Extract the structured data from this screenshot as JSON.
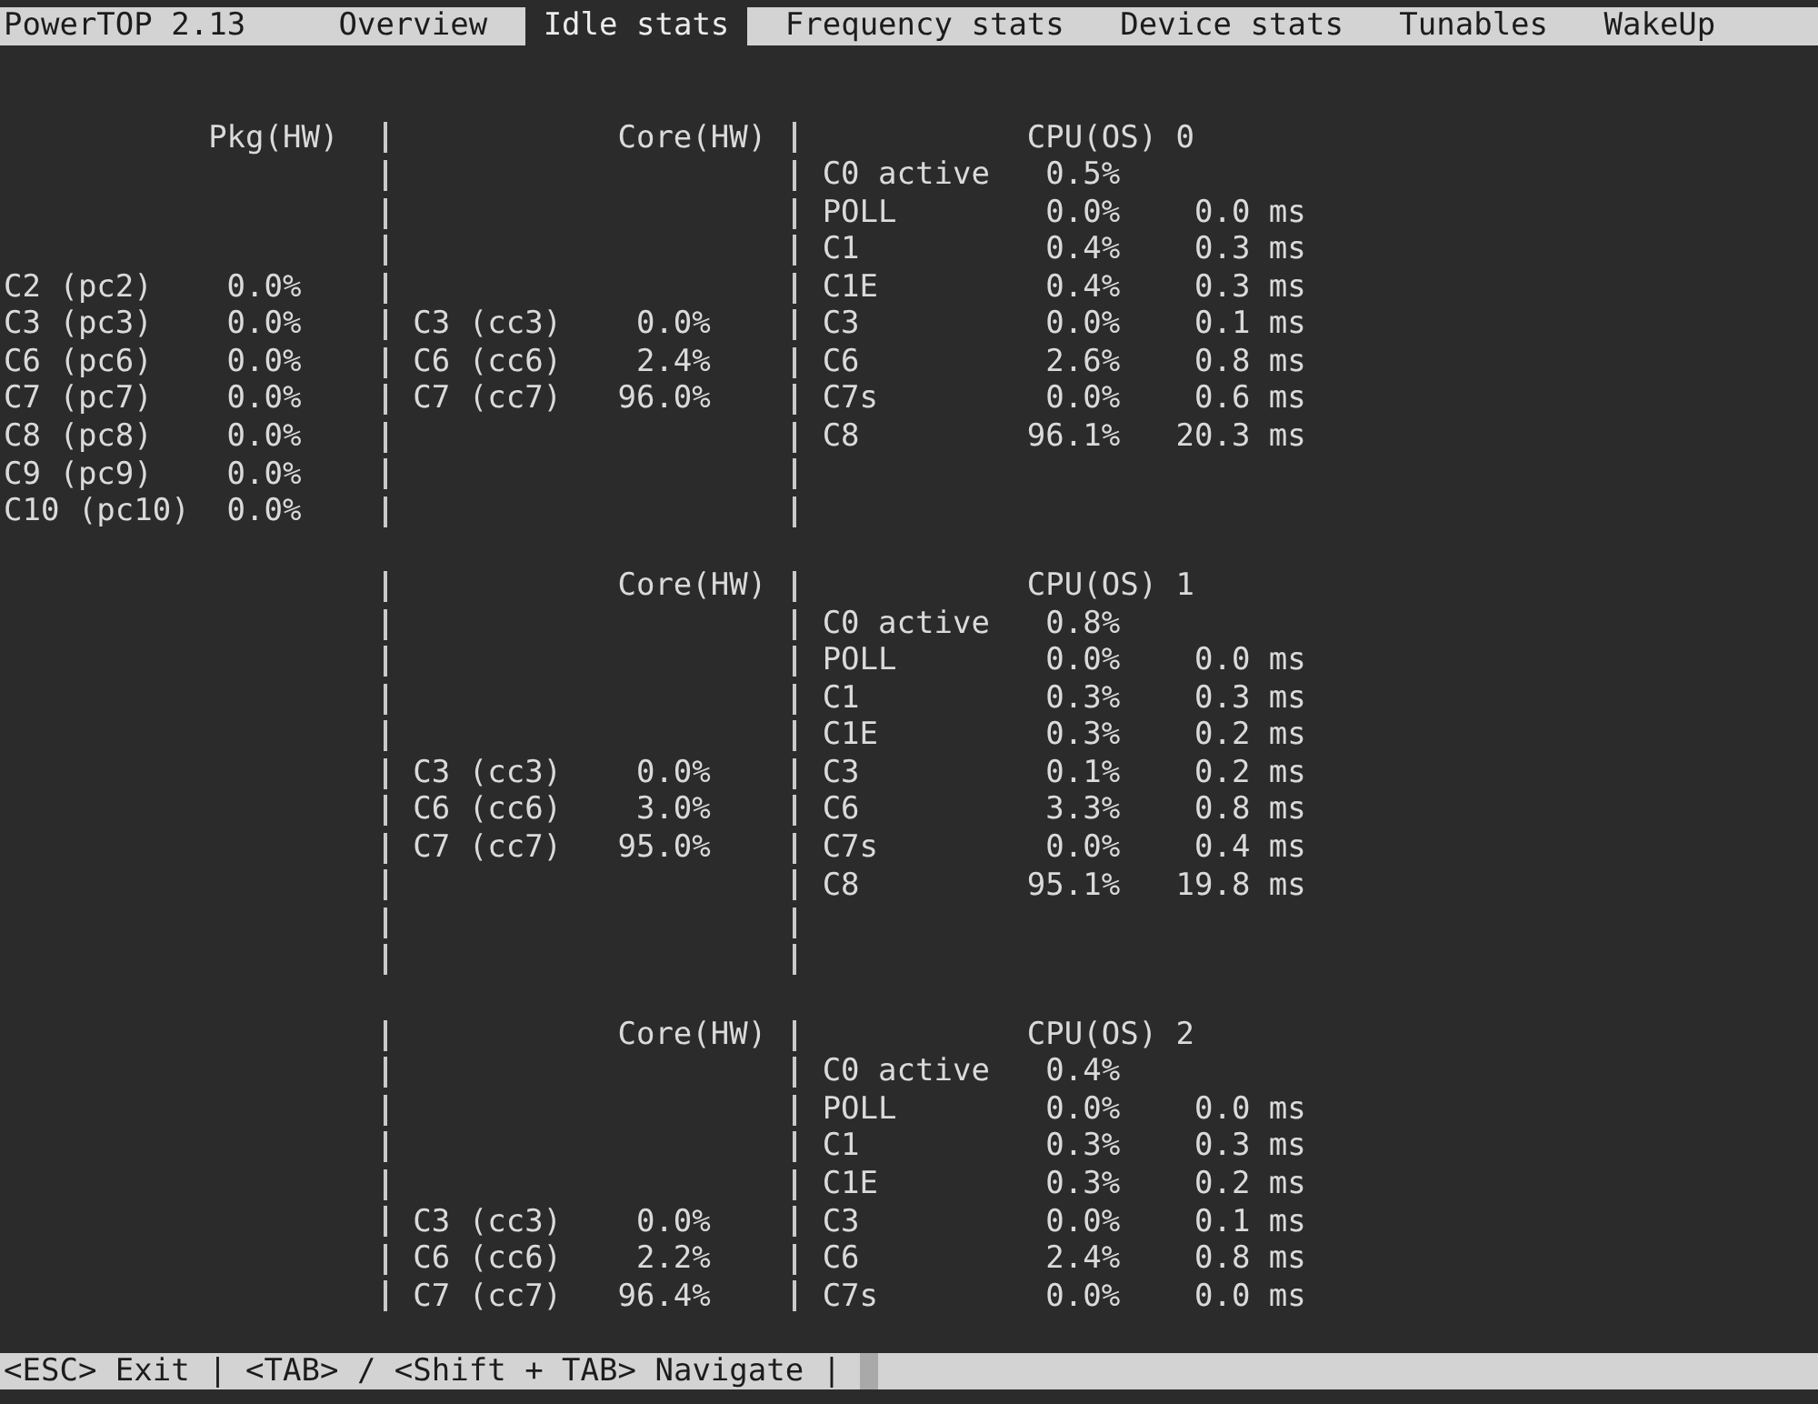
{
  "top_bar": {
    "title": "PowerTOP 2.13",
    "tabs": [
      {
        "label": "Overview",
        "selected": false
      },
      {
        "label": "Idle stats",
        "selected": true
      },
      {
        "label": "Frequency stats",
        "selected": false
      },
      {
        "label": "Device stats",
        "selected": false
      },
      {
        "label": "Tunables",
        "selected": false
      },
      {
        "label": "WakeUp",
        "selected": false
      }
    ]
  },
  "blocks": [
    {
      "package_heading": "Pkg(HW)",
      "core_heading": "Core(HW)",
      "cpu_heading": "CPU(OS) 0",
      "rows": [
        {
          "cpu": {
            "state": "C0 active",
            "percent": "0.5%"
          }
        },
        {
          "cpu": {
            "state": "POLL",
            "percent": "0.0%",
            "time": "0.0 ms"
          }
        },
        {
          "cpu": {
            "state": "C1",
            "percent": "0.4%",
            "time": "0.3 ms"
          }
        },
        {
          "package": {
            "state": "C2 (pc2)",
            "percent": "0.0%"
          },
          "cpu": {
            "state": "C1E",
            "percent": "0.4%",
            "time": "0.3 ms"
          }
        },
        {
          "package": {
            "state": "C3 (pc3)",
            "percent": "0.0%"
          },
          "core": {
            "state": "C3 (cc3)",
            "percent": "0.0%"
          },
          "cpu": {
            "state": "C3",
            "percent": "0.0%",
            "time": "0.1 ms"
          }
        },
        {
          "package": {
            "state": "C6 (pc6)",
            "percent": "0.0%"
          },
          "core": {
            "state": "C6 (cc6)",
            "percent": "2.4%"
          },
          "cpu": {
            "state": "C6",
            "percent": "2.6%",
            "time": "0.8 ms"
          }
        },
        {
          "package": {
            "state": "C7 (pc7)",
            "percent": "0.0%"
          },
          "core": {
            "state": "C7 (cc7)",
            "percent": "96.0%"
          },
          "cpu": {
            "state": "C7s",
            "percent": "0.0%",
            "time": "0.6 ms"
          }
        },
        {
          "package": {
            "state": "C8 (pc8)",
            "percent": "0.0%"
          },
          "cpu": {
            "state": "C8",
            "percent": "96.1%",
            "time": "20.3 ms"
          }
        },
        {
          "package": {
            "state": "C9 (pc9)",
            "percent": "0.0%"
          }
        },
        {
          "package": {
            "state": "C10 (pc10)",
            "percent": "0.0%"
          }
        }
      ]
    },
    {
      "core_heading": "Core(HW)",
      "cpu_heading": "CPU(OS) 1",
      "rows": [
        {
          "cpu": {
            "state": "C0 active",
            "percent": "0.8%"
          }
        },
        {
          "cpu": {
            "state": "POLL",
            "percent": "0.0%",
            "time": "0.0 ms"
          }
        },
        {
          "cpu": {
            "state": "C1",
            "percent": "0.3%",
            "time": "0.3 ms"
          }
        },
        {
          "cpu": {
            "state": "C1E",
            "percent": "0.3%",
            "time": "0.2 ms"
          }
        },
        {
          "core": {
            "state": "C3 (cc3)",
            "percent": "0.0%"
          },
          "cpu": {
            "state": "C3",
            "percent": "0.1%",
            "time": "0.2 ms"
          }
        },
        {
          "core": {
            "state": "C6 (cc6)",
            "percent": "3.0%"
          },
          "cpu": {
            "state": "C6",
            "percent": "3.3%",
            "time": "0.8 ms"
          }
        },
        {
          "core": {
            "state": "C7 (cc7)",
            "percent": "95.0%"
          },
          "cpu": {
            "state": "C7s",
            "percent": "0.0%",
            "time": "0.4 ms"
          }
        },
        {
          "cpu": {
            "state": "C8",
            "percent": "95.1%",
            "time": "19.8 ms"
          }
        }
      ]
    },
    {
      "core_heading": "Core(HW)",
      "cpu_heading": "CPU(OS) 2",
      "rows": [
        {
          "cpu": {
            "state": "C0 active",
            "percent": "0.4%"
          }
        },
        {
          "cpu": {
            "state": "POLL",
            "percent": "0.0%",
            "time": "0.0 ms"
          }
        },
        {
          "cpu": {
            "state": "C1",
            "percent": "0.3%",
            "time": "0.3 ms"
          }
        },
        {
          "cpu": {
            "state": "C1E",
            "percent": "0.3%",
            "time": "0.2 ms"
          }
        },
        {
          "core": {
            "state": "C3 (cc3)",
            "percent": "0.0%"
          },
          "cpu": {
            "state": "C3",
            "percent": "0.0%",
            "time": "0.1 ms"
          }
        },
        {
          "core": {
            "state": "C6 (cc6)",
            "percent": "2.2%"
          },
          "cpu": {
            "state": "C6",
            "percent": "2.4%",
            "time": "0.8 ms"
          }
        },
        {
          "core": {
            "state": "C7 (cc7)",
            "percent": "96.4%"
          },
          "cpu": {
            "state": "C7s",
            "percent": "0.0%",
            "time": "0.0 ms"
          }
        }
      ]
    }
  ],
  "status_bar": {
    "text": "<ESC> Exit | <TAB> / <Shift + TAB> Navigate |"
  }
}
